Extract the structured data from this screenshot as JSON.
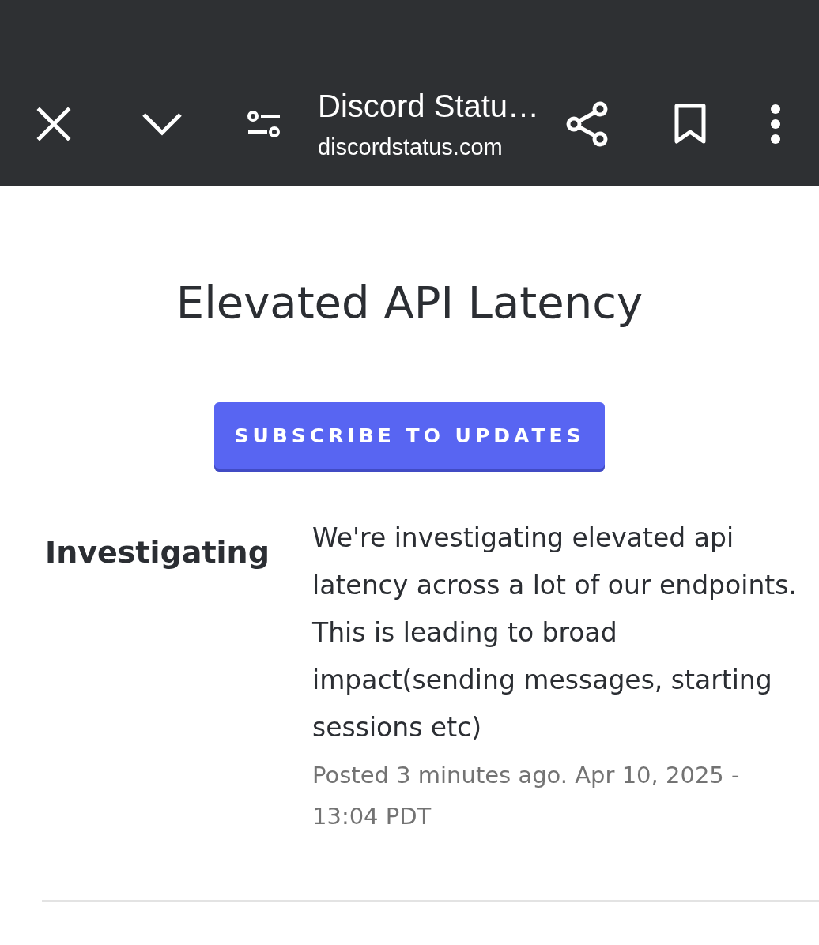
{
  "toolbar": {
    "title": "Discord Statu…",
    "url": "discordstatus.com"
  },
  "incident": {
    "title": "Elevated API Latency",
    "subscribe_button": "SUBSCRIBE TO UPDATES",
    "updates": [
      {
        "status": "Investigating",
        "message": "We're investigating elevated api latency across a lot of our endpoints. This is leading to broad impact(sending messages, starting sessions etc)",
        "posted": "Posted 3 minutes ago. Apr 10, 2025 - 13:04 PDT"
      }
    ]
  }
}
